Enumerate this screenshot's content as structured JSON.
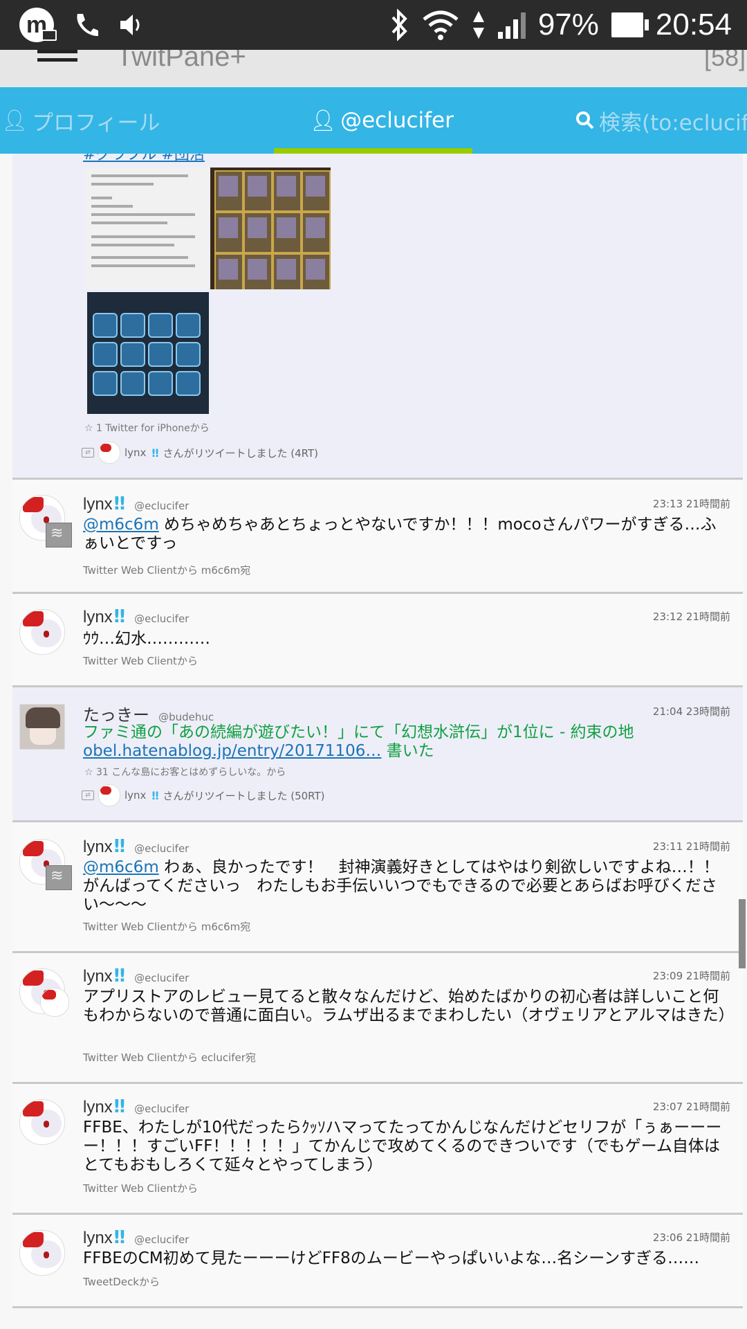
{
  "status_bar": {
    "app_icon": "m",
    "battery_percent": "97%",
    "time": "20:54",
    "icons": [
      "phone-icon",
      "volume-icon",
      "bluetooth-icon",
      "wifi-icon",
      "signal-icon",
      "battery-icon"
    ]
  },
  "app": {
    "title": "TwitPane+",
    "unread_count": "[58]"
  },
  "tabs": [
    {
      "label": "プロフィール",
      "icon": "person-icon",
      "active": false
    },
    {
      "label": "@eclucifer",
      "icon": "person-icon",
      "active": true
    },
    {
      "label": "検索(to:eclucifer",
      "icon": "search-icon",
      "active": false
    }
  ],
  "tweets": [
    {
      "hashtags": "#グラブル #団活",
      "favorites": "1",
      "client": "Twitter for iPhoneから",
      "retweeter": "lynx",
      "retweet_text": "さんがリツイートしました (4RT)"
    },
    {
      "name": "lynx",
      "handle": "@eclucifer",
      "time": "23:13 21時間前",
      "mention": "@m6c6m",
      "text": " めちゃめちゃあとちょっとやないですか！！！mocoさんパワーがすぎる…ふぁいとですっ",
      "via": "Twitter Web Clientから m6c6m宛"
    },
    {
      "name": "lynx",
      "handle": "@eclucifer",
      "time": "23:12 21時間前",
      "text": "ｳｳ…幻水…………",
      "via": "Twitter Web Clientから"
    },
    {
      "name": "たっきー",
      "handle": "@budehuc",
      "time": "21:04 23時間前",
      "text": "ファミ通の「あの続編が遊びたい！」にて「幻想水滸伝」が1位に - 約束の地",
      "link": "obel.hatenablog.jp/entry/20171106…",
      "text_suffix": " 書いた",
      "favorites": "31",
      "client": "こんな島にお客とはめずらしいな。から",
      "retweeter": "lynx",
      "retweet_text": "さんがリツイートしました (50RT)"
    },
    {
      "name": "lynx",
      "handle": "@eclucifer",
      "time": "23:11 21時間前",
      "mention": "@m6c6m",
      "text": " わぁ、良かったです！　封神演義好きとしてはやはり剣欲しいですよね…！！がんばってくださいっ　わたしもお手伝いいつでもできるので必要とあらばお呼びください〜〜〜",
      "via": "Twitter Web Clientから m6c6m宛"
    },
    {
      "name": "lynx",
      "handle": "@eclucifer",
      "time": "23:09 21時間前",
      "text": "アプリストアのレビュー見てると散々なんだけど、始めたばかりの初心者は詳しいこと何もわからないので普通に面白い。ラムザ出るまでまわしたい（オヴェリアとアルマはきた）",
      "via": "Twitter Web Clientから eclucifer宛"
    },
    {
      "name": "lynx",
      "handle": "@eclucifer",
      "time": "23:07 21時間前",
      "text": "FFBE、わたしが10代だったらｸｯｿハマってたってかんじなんだけどセリフが「ぅぁーーーー！！！すごいFF！！！！！」てかんじで攻めてくるのできついです（でもゲーム自体はとてもおもしろくて延々とやってしまう）",
      "via": "Twitter Web Clientから"
    },
    {
      "name": "lynx",
      "handle": "@eclucifer",
      "time": "23:06 21時間前",
      "text": "FFBEのCM初めて見たーーーけどFF8のムービーやっぱいいよな…名シーンすぎる……",
      "via": "TweetDeckから"
    }
  ]
}
